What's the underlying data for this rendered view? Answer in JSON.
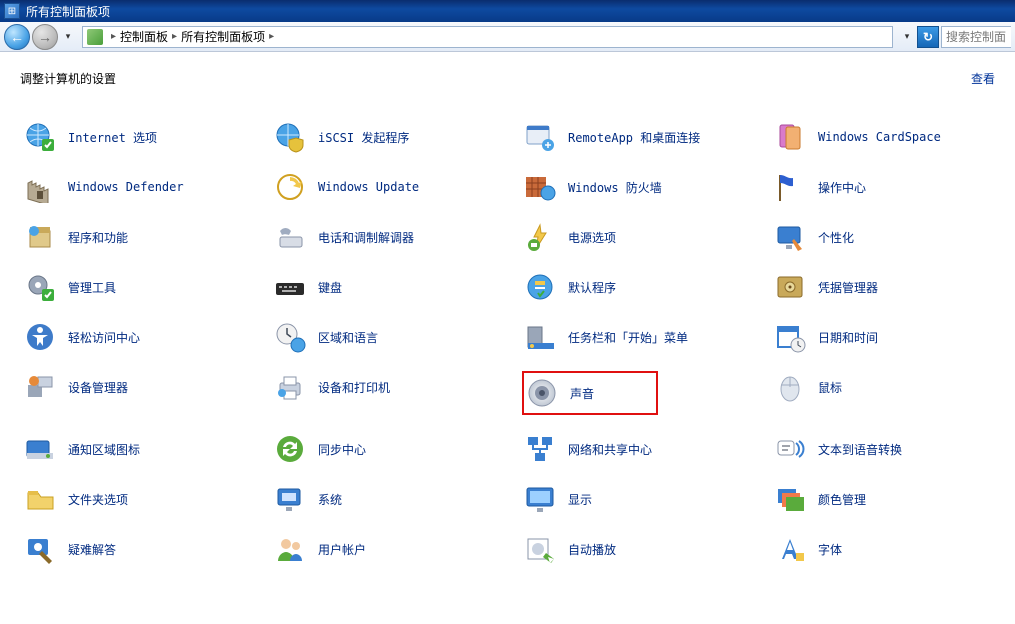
{
  "window": {
    "title": "所有控制面板项"
  },
  "nav": {
    "breadcrumb": [
      "控制面板",
      "所有控制面板项"
    ],
    "search_placeholder": "搜索控制面"
  },
  "header": {
    "heading": "调整计算机的设置",
    "view_link": "查看"
  },
  "items": [
    {
      "id": "internet-options",
      "label": "Internet 选项",
      "icon": "globe-check"
    },
    {
      "id": "iscsi-initiator",
      "label": "iSCSI 发起程序",
      "icon": "globe-shield"
    },
    {
      "id": "remoteapp",
      "label": "RemoteApp 和桌面连接",
      "icon": "window-remote"
    },
    {
      "id": "cardspace",
      "label": "Windows CardSpace",
      "icon": "card"
    },
    {
      "id": "defender",
      "label": "Windows Defender",
      "icon": "castle"
    },
    {
      "id": "update",
      "label": "Windows Update",
      "icon": "update"
    },
    {
      "id": "firewall",
      "label": "Windows 防火墙",
      "icon": "brick-globe"
    },
    {
      "id": "action-center",
      "label": "操作中心",
      "icon": "flag"
    },
    {
      "id": "programs",
      "label": "程序和功能",
      "icon": "box"
    },
    {
      "id": "phone-modem",
      "label": "电话和调制解调器",
      "icon": "phone"
    },
    {
      "id": "power",
      "label": "电源选项",
      "icon": "battery"
    },
    {
      "id": "personalize",
      "label": "个性化",
      "icon": "monitor-paint"
    },
    {
      "id": "admin-tools",
      "label": "管理工具",
      "icon": "gear-check"
    },
    {
      "id": "keyboard",
      "label": "键盘",
      "icon": "keyboard"
    },
    {
      "id": "defaults",
      "label": "默认程序",
      "icon": "defaults"
    },
    {
      "id": "credentials",
      "label": "凭据管理器",
      "icon": "safe"
    },
    {
      "id": "ease-access",
      "label": "轻松访问中心",
      "icon": "ease"
    },
    {
      "id": "region",
      "label": "区域和语言",
      "icon": "clock-globe"
    },
    {
      "id": "taskbar",
      "label": "任务栏和「开始」菜单",
      "icon": "taskbar"
    },
    {
      "id": "datetime",
      "label": "日期和时间",
      "icon": "calendar-clock"
    },
    {
      "id": "device-mgr",
      "label": "设备管理器",
      "icon": "devices"
    },
    {
      "id": "devices-printers",
      "label": "设备和打印机",
      "icon": "printer"
    },
    {
      "id": "sound",
      "label": "声音",
      "icon": "speaker",
      "highlight": true
    },
    {
      "id": "mouse",
      "label": "鼠标",
      "icon": "mouse"
    },
    {
      "id": "tray-icons",
      "label": "通知区域图标",
      "icon": "tray"
    },
    {
      "id": "sync",
      "label": "同步中心",
      "icon": "sync"
    },
    {
      "id": "network",
      "label": "网络和共享中心",
      "icon": "network"
    },
    {
      "id": "tts",
      "label": "文本到语音转换",
      "icon": "tts"
    },
    {
      "id": "folder-options",
      "label": "文件夹选项",
      "icon": "folder"
    },
    {
      "id": "system",
      "label": "系统",
      "icon": "system"
    },
    {
      "id": "display",
      "label": "显示",
      "icon": "display"
    },
    {
      "id": "color",
      "label": "颜色管理",
      "icon": "color"
    },
    {
      "id": "troubleshoot",
      "label": "疑难解答",
      "icon": "troubleshoot"
    },
    {
      "id": "users",
      "label": "用户帐户",
      "icon": "users"
    },
    {
      "id": "autoplay",
      "label": "自动播放",
      "icon": "autoplay"
    },
    {
      "id": "fonts",
      "label": "字体",
      "icon": "fonts"
    }
  ]
}
